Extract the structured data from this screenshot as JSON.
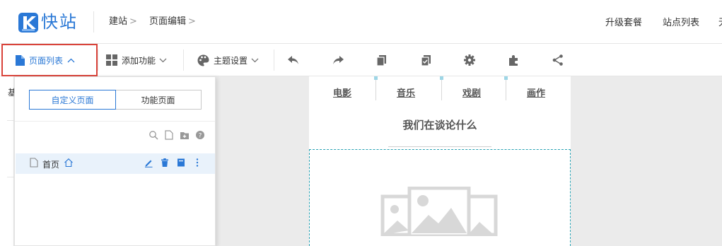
{
  "header": {
    "logo_text": "快站",
    "breadcrumb": [
      {
        "label": "建站",
        "sep": ">"
      },
      {
        "label": "页面编辑",
        "sep": ">"
      }
    ],
    "links": [
      "升级套餐",
      "站点列表",
      "无"
    ]
  },
  "toolbar": {
    "page_list": "页面列表",
    "add_feature": "添加功能",
    "theme_settings": "主题设置",
    "icons": [
      "undo-icon",
      "redo-icon",
      "copy-icon",
      "paste-check-icon",
      "settings-gear-icon",
      "plugin-icon",
      "share-icon"
    ]
  },
  "left_strip": {
    "char": "基"
  },
  "panel": {
    "tabs": [
      {
        "label": "自定义页面",
        "active": true
      },
      {
        "label": "功能页面",
        "active": false
      }
    ],
    "tools": [
      "search-icon",
      "new-page-icon",
      "new-folder-icon",
      "help-icon"
    ],
    "pages": [
      {
        "label": "首页",
        "home": true
      }
    ]
  },
  "preview": {
    "nav": [
      "电影",
      "音乐",
      "戏剧",
      "画作"
    ],
    "section_title": "我们在谈论什么"
  },
  "colors": {
    "accent": "#2a78d6",
    "highlight": "#d9433a",
    "dashed_border": "#2aa3b4",
    "row_active": "#e9f2fb"
  }
}
